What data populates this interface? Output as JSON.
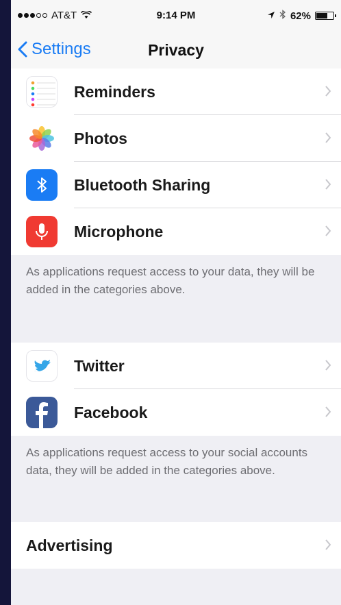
{
  "status_bar": {
    "carrier": "AT&T",
    "time": "9:14 PM",
    "battery_percent": "62%",
    "battery_level": 0.62,
    "icons": [
      "signal-dots-icon",
      "wifi-icon",
      "location-arrow-icon",
      "bluetooth-icon",
      "battery-icon"
    ]
  },
  "nav": {
    "back_label": "Settings",
    "title": "Privacy"
  },
  "group1": {
    "items": [
      {
        "label": "Reminders",
        "icon": "reminders-icon"
      },
      {
        "label": "Photos",
        "icon": "photos-icon"
      },
      {
        "label": "Bluetooth Sharing",
        "icon": "bluetooth-sharing-icon"
      },
      {
        "label": "Microphone",
        "icon": "microphone-icon"
      }
    ],
    "footer": "As applications request access to your data, they will be added in the categories above."
  },
  "group2": {
    "items": [
      {
        "label": "Twitter",
        "icon": "twitter-icon"
      },
      {
        "label": "Facebook",
        "icon": "facebook-icon"
      }
    ],
    "footer": "As applications request access to your social accounts data, they will be added in the categories above."
  },
  "group3": {
    "items": [
      {
        "label": "Advertising"
      }
    ]
  },
  "colors": {
    "accent": "#1a7cf4",
    "bluetooth": "#1a7cf4",
    "microphone": "#f03a32",
    "twitter": "#35a6e8",
    "facebook": "#3b5998"
  }
}
